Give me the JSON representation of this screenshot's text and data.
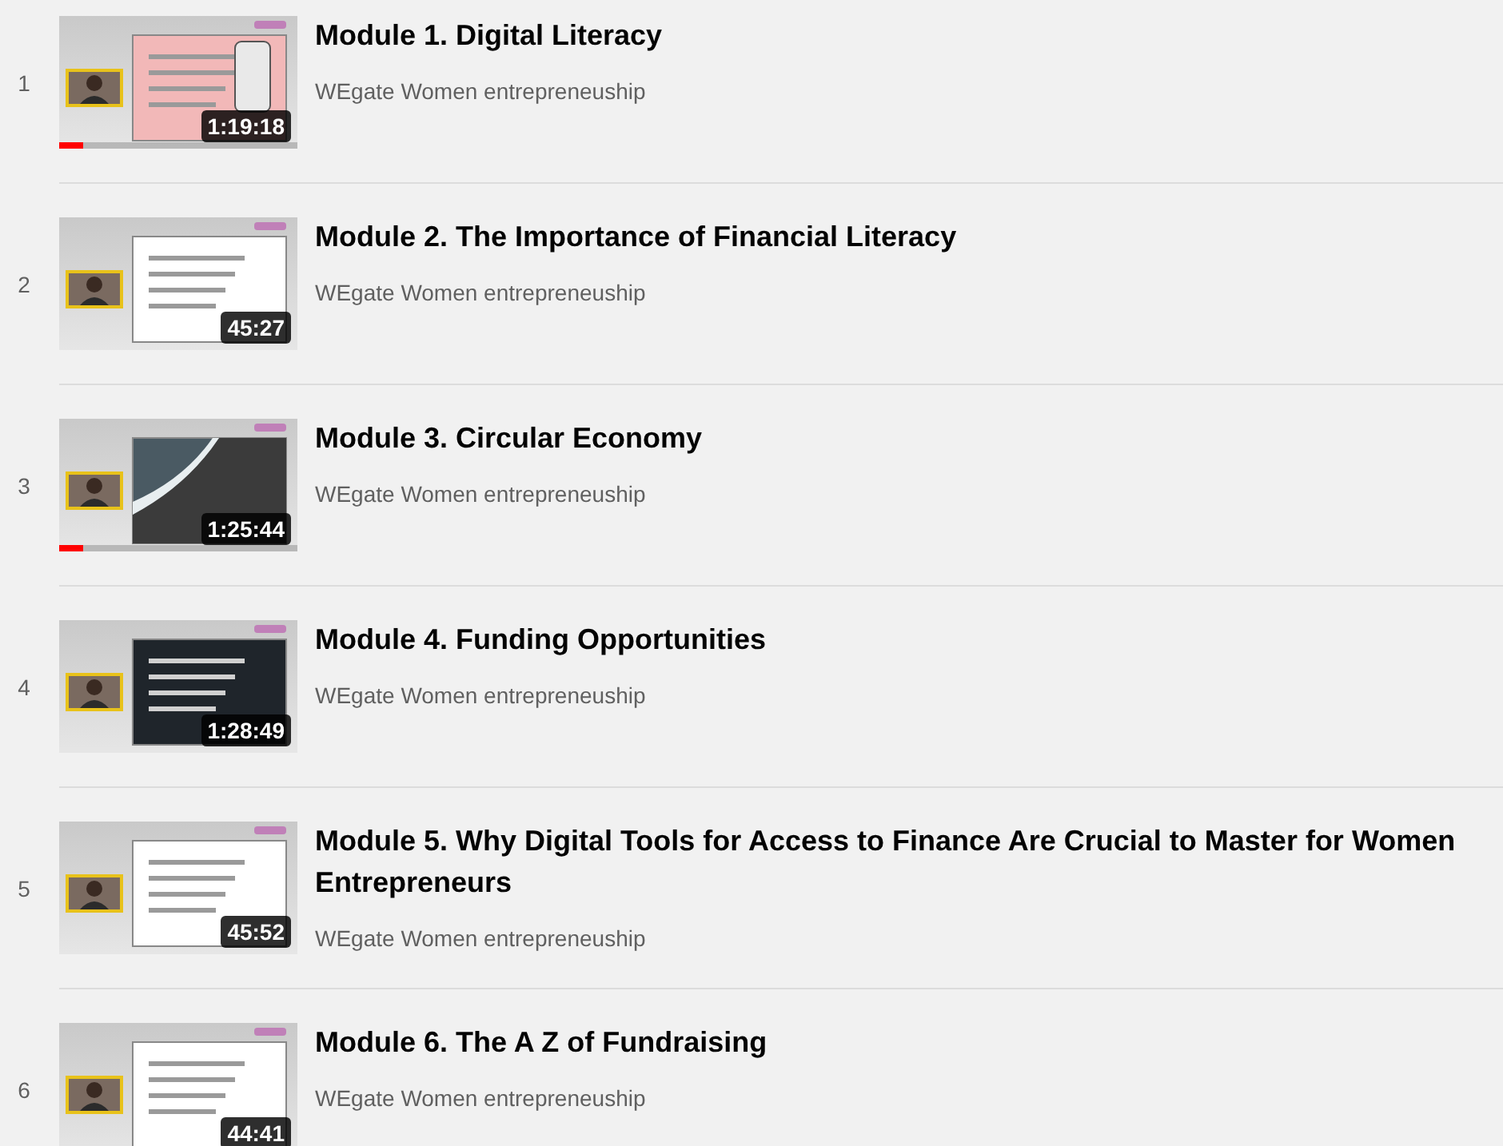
{
  "playlist": [
    {
      "index": "1",
      "title": "Module 1. Digital Literacy",
      "channel": "WEgate Women entrepreneuship",
      "duration": "1:19:18",
      "progress": {
        "level": 0.1
      }
    },
    {
      "index": "2",
      "title": "Module 2. The Importance of Financial Literacy",
      "channel": "WEgate Women entrepreneuship",
      "duration": "45:27"
    },
    {
      "index": "3",
      "title": "Module 3. Circular Economy",
      "channel": "WEgate Women entrepreneuship",
      "duration": "1:25:44",
      "progress": {
        "level": 0.1
      }
    },
    {
      "index": "4",
      "title": "Module 4. Funding Opportunities",
      "channel": "WEgate Women entrepreneuship",
      "duration": "1:28:49"
    },
    {
      "index": "5",
      "title": "Module 5. Why Digital Tools for Access to Finance Are Crucial to Master for Women Entrepreneurs",
      "channel": "WEgate Women entrepreneuship",
      "duration": "45:52"
    },
    {
      "index": "6",
      "title": "Module 6. The A Z of Fundraising",
      "channel": "WEgate Women entrepreneuship",
      "duration": "44:41"
    }
  ]
}
